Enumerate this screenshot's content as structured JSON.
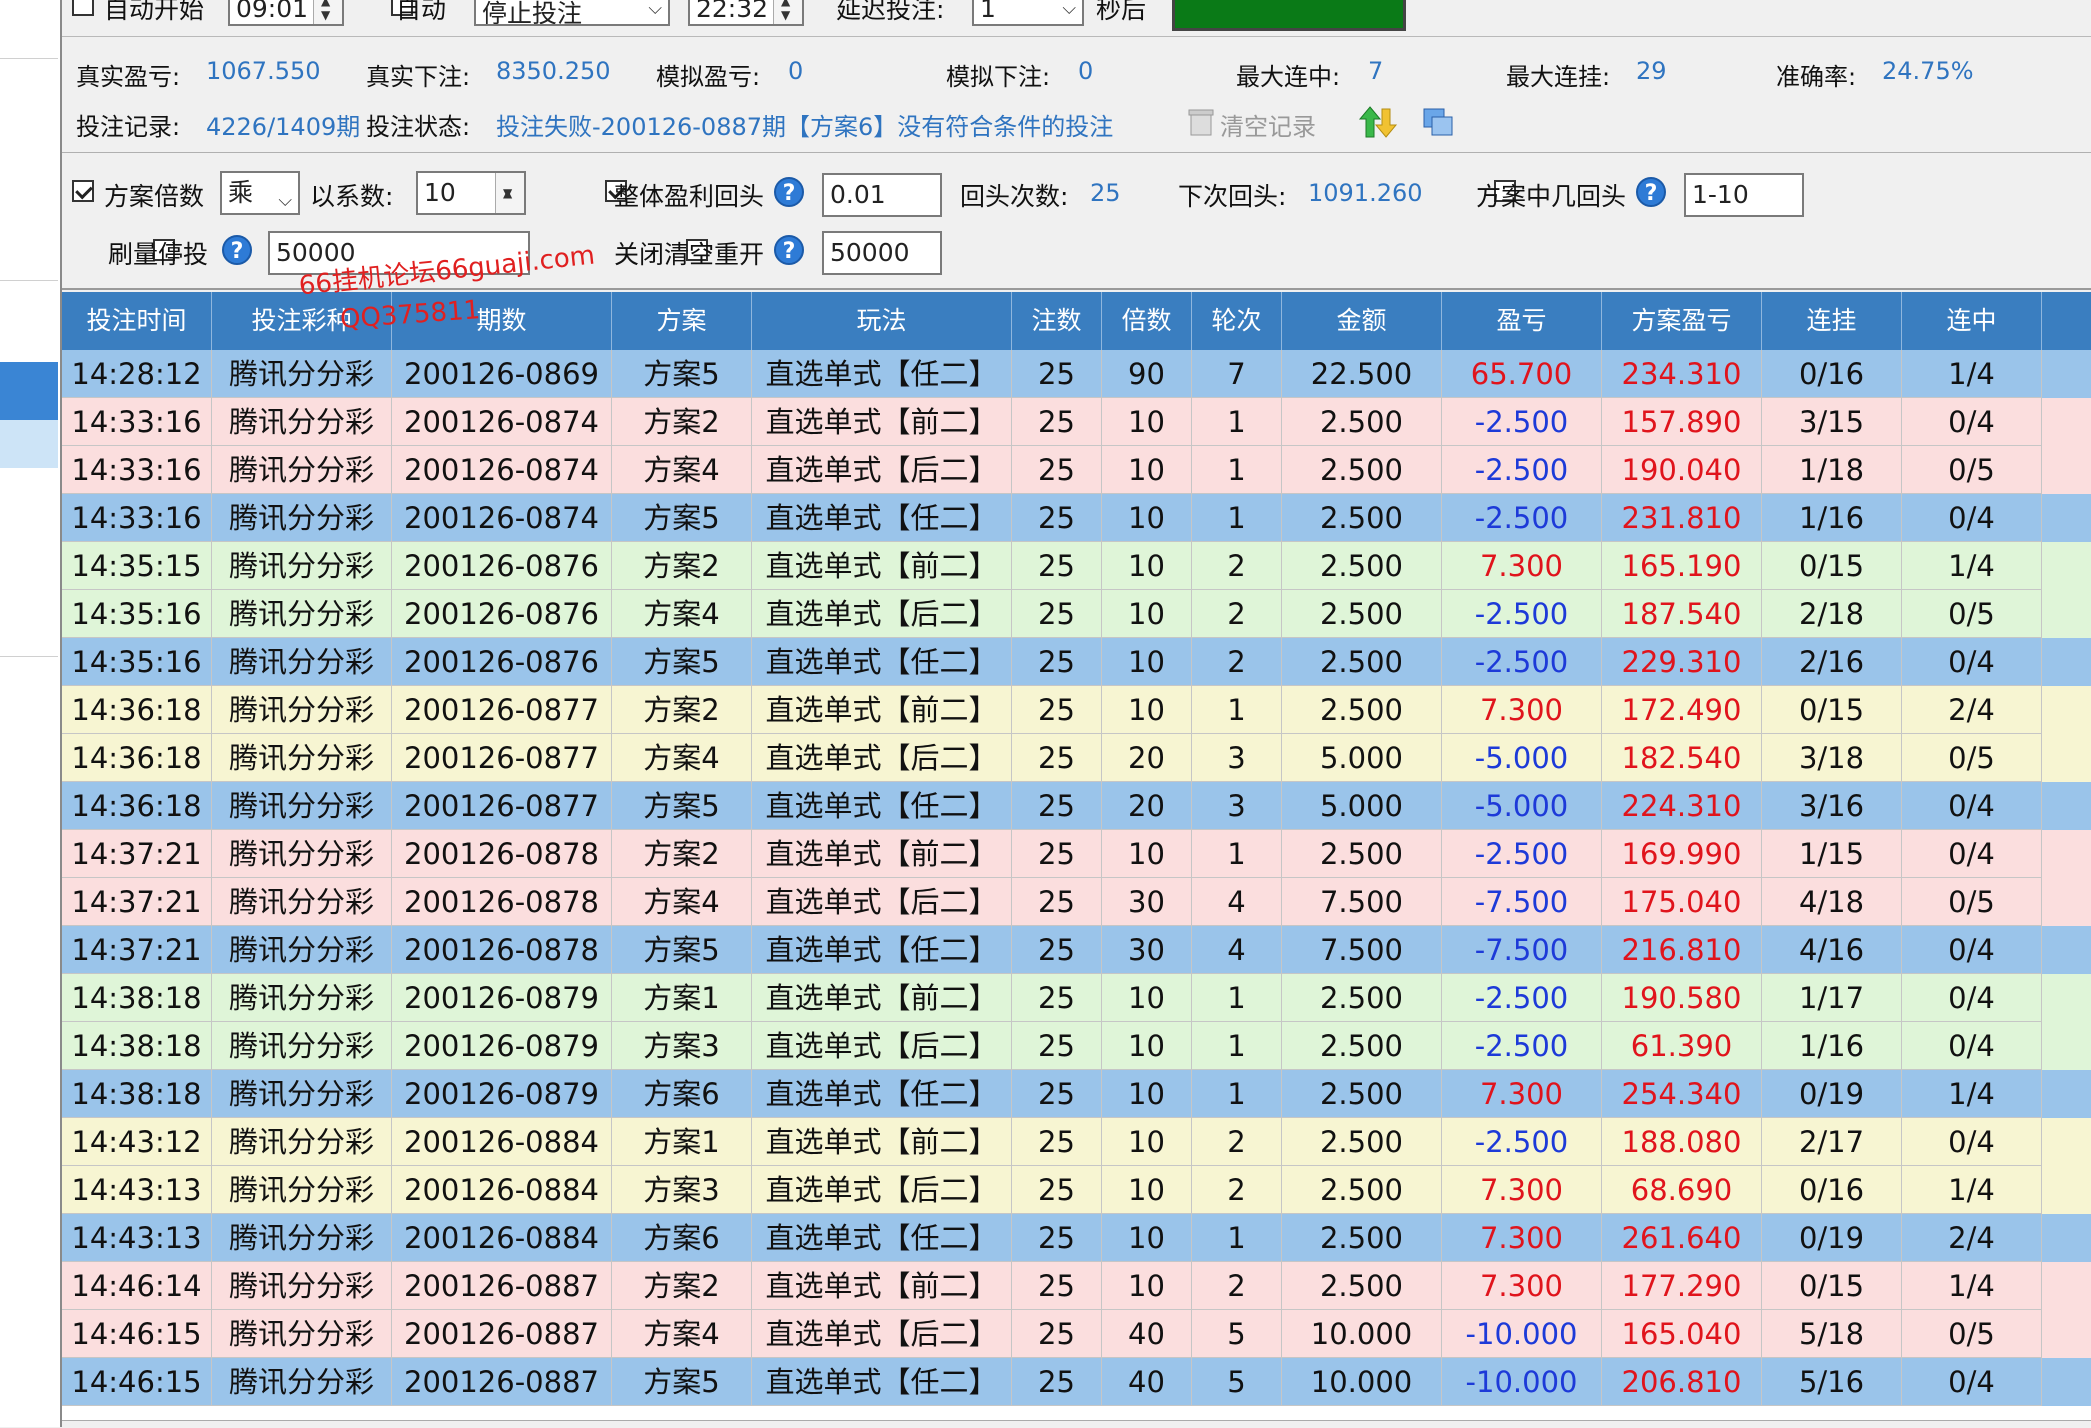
{
  "top": {
    "auto_start_label": "自动开始",
    "start_time": "09:01",
    "auto_label": "自动",
    "mode_select": "停止投注",
    "end_time": "22:32",
    "delay_label": "延迟投注:",
    "delay_value": "1",
    "delay_unit": "秒后"
  },
  "stats": {
    "real_pnl_label": "真实盈亏:",
    "real_pnl": "1067.550",
    "real_bet_label": "真实下注:",
    "real_bet": "8350.250",
    "sim_pnl_label": "模拟盈亏:",
    "sim_pnl": "0",
    "sim_bet_label": "模拟下注:",
    "sim_bet": "0",
    "max_win_streak_label": "最大连中:",
    "max_win_streak": "7",
    "max_lose_streak_label": "最大连挂:",
    "max_lose_streak": "29",
    "accuracy_label": "准确率:",
    "accuracy": "24.75%",
    "record_label": "投注记录:",
    "record": "4226/1409期",
    "status_label": "投注状态:",
    "status": "投注失败-200126-0887期【方案6】没有符合条件的投注",
    "clear_label": "清空记录"
  },
  "options": {
    "multiplier_label": "方案倍数",
    "op_select": "乘",
    "factor_label": "以系数:",
    "factor_value": "10",
    "overall_return_label": "整体盈利回头",
    "overall_return_value": "0.01",
    "return_count_label": "回头次数:",
    "return_count": "25",
    "next_return_label": "下次回头:",
    "next_return": "1091.260",
    "hit_return_label": "方案中几回头",
    "hit_return_value": "1-10",
    "stop_label": "刷量停投",
    "stop_value": "50000",
    "close_clear_label": "关闭清空重开",
    "close_clear_value": "50000"
  },
  "watermark": {
    "line1": "66挂机论坛66guaji.com",
    "line2": "QQ375811"
  },
  "table": {
    "headers": [
      "投注时间",
      "投注彩种",
      "期数",
      "方案",
      "玩法",
      "注数",
      "倍数",
      "轮次",
      "金额",
      "盈亏",
      "方案盈亏",
      "连挂",
      "连中"
    ],
    "rows": [
      {
        "c": "blue",
        "v": [
          "14:28:12",
          "腾讯分分彩",
          "200126-0869",
          "方案5",
          "直选单式【任二】",
          "25",
          "90",
          "7",
          "22.500",
          "65.700",
          "234.310",
          "0/16",
          "1/4"
        ],
        "pos": true
      },
      {
        "c": "pink",
        "v": [
          "14:33:16",
          "腾讯分分彩",
          "200126-0874",
          "方案2",
          "直选单式【前二】",
          "25",
          "10",
          "1",
          "2.500",
          "-2.500",
          "157.890",
          "3/15",
          "0/4"
        ],
        "pos": false
      },
      {
        "c": "pink",
        "v": [
          "14:33:16",
          "腾讯分分彩",
          "200126-0874",
          "方案4",
          "直选单式【后二】",
          "25",
          "10",
          "1",
          "2.500",
          "-2.500",
          "190.040",
          "1/18",
          "0/5"
        ],
        "pos": false
      },
      {
        "c": "blue",
        "v": [
          "14:33:16",
          "腾讯分分彩",
          "200126-0874",
          "方案5",
          "直选单式【任二】",
          "25",
          "10",
          "1",
          "2.500",
          "-2.500",
          "231.810",
          "1/16",
          "0/4"
        ],
        "pos": false
      },
      {
        "c": "green",
        "v": [
          "14:35:15",
          "腾讯分分彩",
          "200126-0876",
          "方案2",
          "直选单式【前二】",
          "25",
          "10",
          "2",
          "2.500",
          "7.300",
          "165.190",
          "0/15",
          "1/4"
        ],
        "pos": true
      },
      {
        "c": "green",
        "v": [
          "14:35:16",
          "腾讯分分彩",
          "200126-0876",
          "方案4",
          "直选单式【后二】",
          "25",
          "10",
          "2",
          "2.500",
          "-2.500",
          "187.540",
          "2/18",
          "0/5"
        ],
        "pos": false
      },
      {
        "c": "blue",
        "v": [
          "14:35:16",
          "腾讯分分彩",
          "200126-0876",
          "方案5",
          "直选单式【任二】",
          "25",
          "10",
          "2",
          "2.500",
          "-2.500",
          "229.310",
          "2/16",
          "0/4"
        ],
        "pos": false
      },
      {
        "c": "yellow",
        "v": [
          "14:36:18",
          "腾讯分分彩",
          "200126-0877",
          "方案2",
          "直选单式【前二】",
          "25",
          "10",
          "1",
          "2.500",
          "7.300",
          "172.490",
          "0/15",
          "2/4"
        ],
        "pos": true
      },
      {
        "c": "yellow",
        "v": [
          "14:36:18",
          "腾讯分分彩",
          "200126-0877",
          "方案4",
          "直选单式【后二】",
          "25",
          "20",
          "3",
          "5.000",
          "-5.000",
          "182.540",
          "3/18",
          "0/5"
        ],
        "pos": false
      },
      {
        "c": "blue",
        "v": [
          "14:36:18",
          "腾讯分分彩",
          "200126-0877",
          "方案5",
          "直选单式【任二】",
          "25",
          "20",
          "3",
          "5.000",
          "-5.000",
          "224.310",
          "3/16",
          "0/4"
        ],
        "pos": false
      },
      {
        "c": "pink",
        "v": [
          "14:37:21",
          "腾讯分分彩",
          "200126-0878",
          "方案2",
          "直选单式【前二】",
          "25",
          "10",
          "1",
          "2.500",
          "-2.500",
          "169.990",
          "1/15",
          "0/4"
        ],
        "pos": false
      },
      {
        "c": "pink",
        "v": [
          "14:37:21",
          "腾讯分分彩",
          "200126-0878",
          "方案4",
          "直选单式【后二】",
          "25",
          "30",
          "4",
          "7.500",
          "-7.500",
          "175.040",
          "4/18",
          "0/5"
        ],
        "pos": false
      },
      {
        "c": "blue",
        "v": [
          "14:37:21",
          "腾讯分分彩",
          "200126-0878",
          "方案5",
          "直选单式【任二】",
          "25",
          "30",
          "4",
          "7.500",
          "-7.500",
          "216.810",
          "4/16",
          "0/4"
        ],
        "pos": false
      },
      {
        "c": "green",
        "v": [
          "14:38:18",
          "腾讯分分彩",
          "200126-0879",
          "方案1",
          "直选单式【前二】",
          "25",
          "10",
          "1",
          "2.500",
          "-2.500",
          "190.580",
          "1/17",
          "0/4"
        ],
        "pos": false
      },
      {
        "c": "green",
        "v": [
          "14:38:18",
          "腾讯分分彩",
          "200126-0879",
          "方案3",
          "直选单式【后二】",
          "25",
          "10",
          "1",
          "2.500",
          "-2.500",
          "61.390",
          "1/16",
          "0/4"
        ],
        "pos": false
      },
      {
        "c": "blue",
        "v": [
          "14:38:18",
          "腾讯分分彩",
          "200126-0879",
          "方案6",
          "直选单式【任二】",
          "25",
          "10",
          "1",
          "2.500",
          "7.300",
          "254.340",
          "0/19",
          "1/4"
        ],
        "pos": true
      },
      {
        "c": "yellow",
        "v": [
          "14:43:12",
          "腾讯分分彩",
          "200126-0884",
          "方案1",
          "直选单式【前二】",
          "25",
          "10",
          "2",
          "2.500",
          "-2.500",
          "188.080",
          "2/17",
          "0/4"
        ],
        "pos": false
      },
      {
        "c": "yellow",
        "v": [
          "14:43:13",
          "腾讯分分彩",
          "200126-0884",
          "方案3",
          "直选单式【后二】",
          "25",
          "10",
          "2",
          "2.500",
          "7.300",
          "68.690",
          "0/16",
          "1/4"
        ],
        "pos": true
      },
      {
        "c": "blue",
        "v": [
          "14:43:13",
          "腾讯分分彩",
          "200126-0884",
          "方案6",
          "直选单式【任二】",
          "25",
          "10",
          "1",
          "2.500",
          "7.300",
          "261.640",
          "0/19",
          "2/4"
        ],
        "pos": true
      },
      {
        "c": "pink",
        "v": [
          "14:46:14",
          "腾讯分分彩",
          "200126-0887",
          "方案2",
          "直选单式【前二】",
          "25",
          "10",
          "2",
          "2.500",
          "7.300",
          "177.290",
          "0/15",
          "1/4"
        ],
        "pos": true
      },
      {
        "c": "pink",
        "v": [
          "14:46:15",
          "腾讯分分彩",
          "200126-0887",
          "方案4",
          "直选单式【后二】",
          "25",
          "40",
          "5",
          "10.000",
          "-10.000",
          "165.040",
          "5/18",
          "0/5"
        ],
        "pos": false
      },
      {
        "c": "blue",
        "v": [
          "14:46:15",
          "腾讯分分彩",
          "200126-0887",
          "方案5",
          "直选单式【任二】",
          "25",
          "40",
          "5",
          "10.000",
          "-10.000",
          "206.810",
          "5/16",
          "0/4"
        ],
        "pos": false
      }
    ]
  },
  "colors": {
    "header_bg": "#3a7ec0",
    "positive": "#e0141c",
    "negative": "#1d3ad8",
    "value": "#2f74c0",
    "status_green": "#0a7a17"
  }
}
